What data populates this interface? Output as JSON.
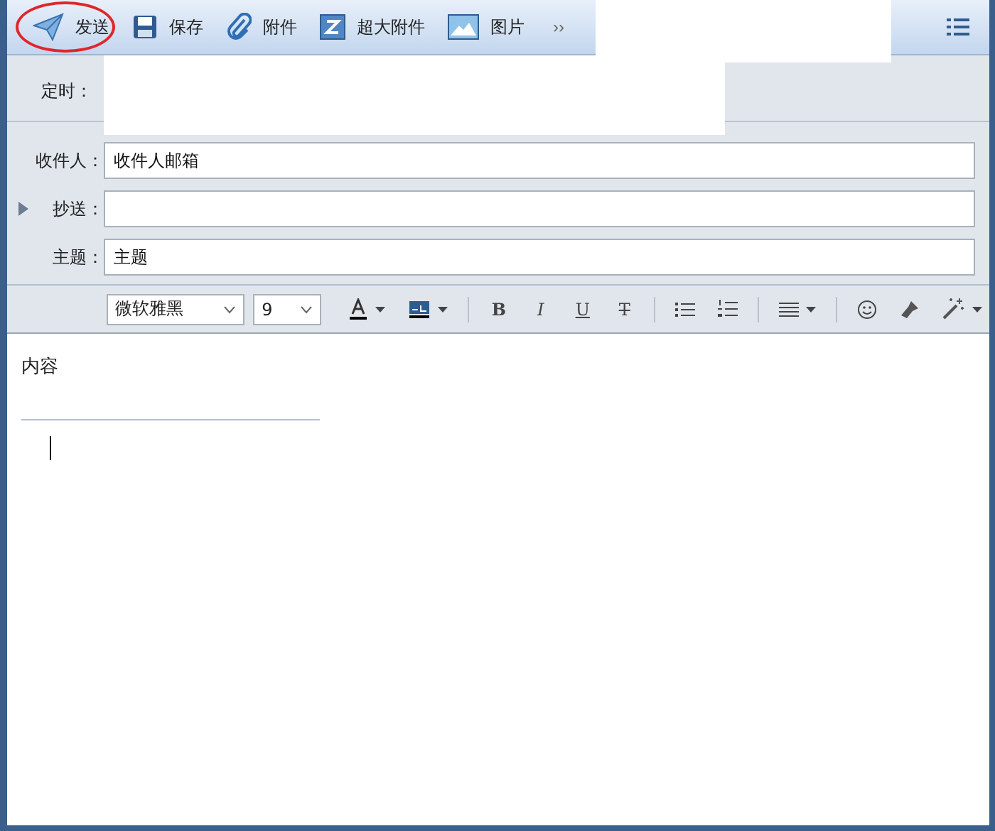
{
  "toolbar": {
    "buttons": [
      {
        "kind": "send",
        "label": "发送",
        "highlighted": true
      },
      {
        "kind": "save",
        "label": "保存",
        "highlighted": false
      },
      {
        "kind": "attach",
        "label": "附件",
        "highlighted": false
      },
      {
        "kind": "bigfile",
        "label": "超大附件",
        "highlighted": false
      },
      {
        "kind": "image",
        "label": "图片",
        "highlighted": false
      }
    ],
    "more": "››"
  },
  "schedule": {
    "label": "定时："
  },
  "fields": [
    {
      "label": "收件人：",
      "value": "收件人邮箱",
      "kind": "plain"
    },
    {
      "label": "抄送：",
      "kind": "expandable",
      "expanded": false
    },
    {
      "label": "主题：",
      "value": "主题",
      "kind": "plain"
    }
  ],
  "format_bar": {
    "font": "微软雅黑",
    "size": "9",
    "tools": [
      {
        "kind": "font-color",
        "dropdown": true
      },
      {
        "kind": "highlight",
        "dropdown": true
      },
      {
        "kind": "sep"
      },
      {
        "kind": "bold",
        "label": "B"
      },
      {
        "kind": "italic",
        "label": "I"
      },
      {
        "kind": "underline",
        "label": "U"
      },
      {
        "kind": "strike",
        "label": "T"
      },
      {
        "kind": "sep"
      },
      {
        "kind": "bullet-list",
        "dropdown": false
      },
      {
        "kind": "numbered-list",
        "dropdown": false
      },
      {
        "kind": "sep"
      },
      {
        "kind": "align",
        "dropdown": true
      },
      {
        "kind": "sep"
      },
      {
        "kind": "emoji",
        "dropdown": false
      },
      {
        "kind": "brush",
        "dropdown": false
      },
      {
        "kind": "magic",
        "dropdown": true
      }
    ]
  },
  "body": {
    "text": "内容"
  }
}
